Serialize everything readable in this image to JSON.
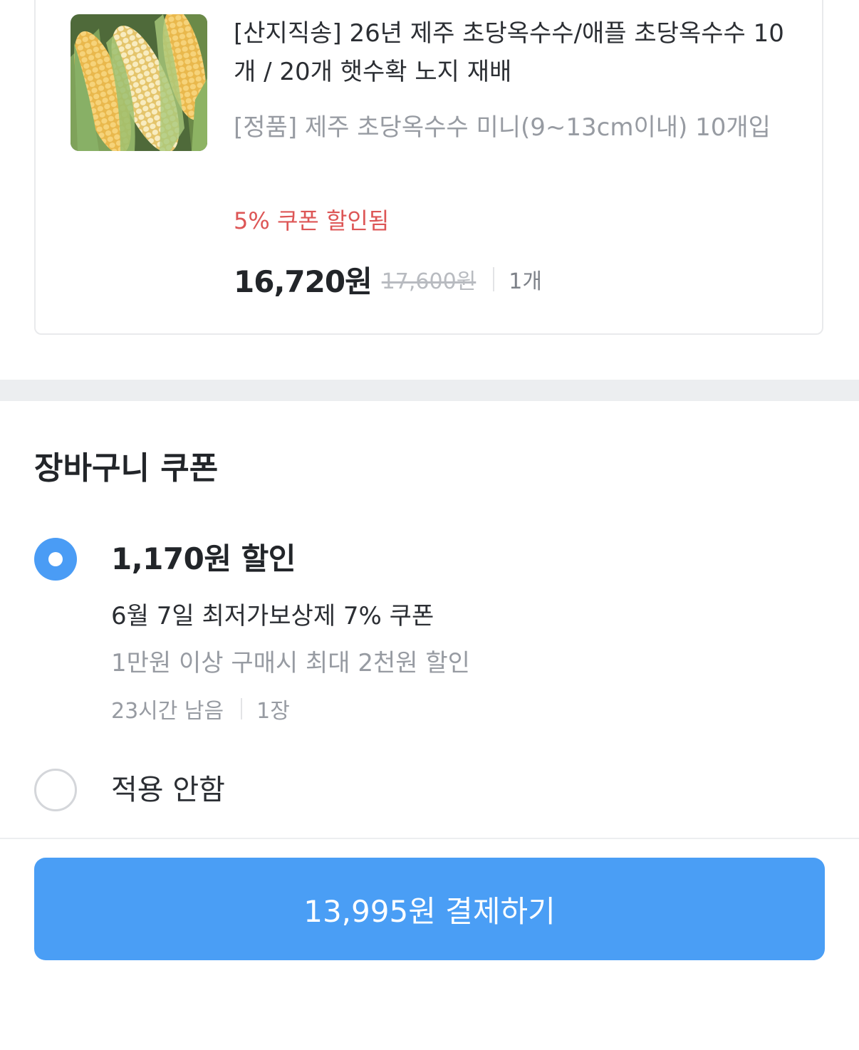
{
  "product": {
    "image_icon": "corn-photo",
    "title": "[산지직송] 26년 제주 초당옥수수/애플 초당옥수수 10개 / 20개 햇수확 노지 재배",
    "option": "[정품] 제주 초당옥수수 미니(9~13cm이내) 10개입",
    "coupon_note": "5% 쿠폰 할인됨",
    "price": "16,720원",
    "original_price": "17,600원",
    "quantity": "1개"
  },
  "coupon_section": {
    "title": "장바구니 쿠폰",
    "options": [
      {
        "selected": true,
        "amount": "1,170원 할인",
        "name": "6월 7일 최저가보상제 7% 쿠폰",
        "condition": "1만원 이상 구매시 최대 2천원 할인",
        "remaining": "23시간 남음",
        "count": "1장"
      },
      {
        "selected": false,
        "label": "적용 안함"
      }
    ]
  },
  "footer": {
    "pay_label": "13,995원 결제하기"
  },
  "colors": {
    "accent": "#4a9ef5",
    "discount_red": "#dd5656",
    "muted_text": "#979ba2"
  }
}
